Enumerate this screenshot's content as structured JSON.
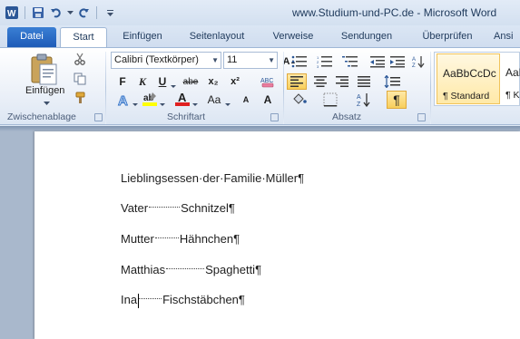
{
  "window": {
    "title": "www.Studium-und-PC.de - Microsoft Word"
  },
  "tabs": [
    {
      "label": "Datei"
    },
    {
      "label": "Start"
    },
    {
      "label": "Einfügen"
    },
    {
      "label": "Seitenlayout"
    },
    {
      "label": "Verweise"
    },
    {
      "label": "Sendungen"
    },
    {
      "label": "Überprüfen"
    },
    {
      "label": "Ansi"
    }
  ],
  "ribbon": {
    "clipboard": {
      "paste_label": "Einfügen",
      "group_label": "Zwischenablage"
    },
    "font": {
      "font_name": "Calibri (Textkörper)",
      "font_size": "11",
      "group_label": "Schriftart",
      "bold": "F",
      "italic": "K",
      "underline": "U",
      "strike": "abe",
      "subscript": "x₂",
      "superscript": "x²",
      "grow": "A",
      "shrink": "A",
      "case": "Aa",
      "clear": "ABC"
    },
    "paragraph": {
      "group_label": "Absatz",
      "pilcrow": "¶"
    },
    "styles": {
      "sample_1": "AaBbCcDc",
      "name_1": "¶ Standard",
      "sample_2": "AaBbC",
      "name_2": "¶ Ke"
    }
  },
  "document": {
    "lines": [
      {
        "parts": [
          "Lieblingsessen·der·Familie·Müller¶"
        ]
      },
      {
        "before": "Vater",
        "after": "Schnitzel¶"
      },
      {
        "before": "Mutter",
        "after": "Hähnchen¶"
      },
      {
        "before": "Matthias",
        "after": "Spaghetti¶"
      },
      {
        "before": "Ina",
        "after": "Fischstäbchen¶"
      }
    ]
  },
  "colors": {
    "file_tab": "#2a6bc8",
    "highlight": "#ffff00",
    "font_color": "#e02020",
    "accent_gold": "#f0c35a"
  }
}
